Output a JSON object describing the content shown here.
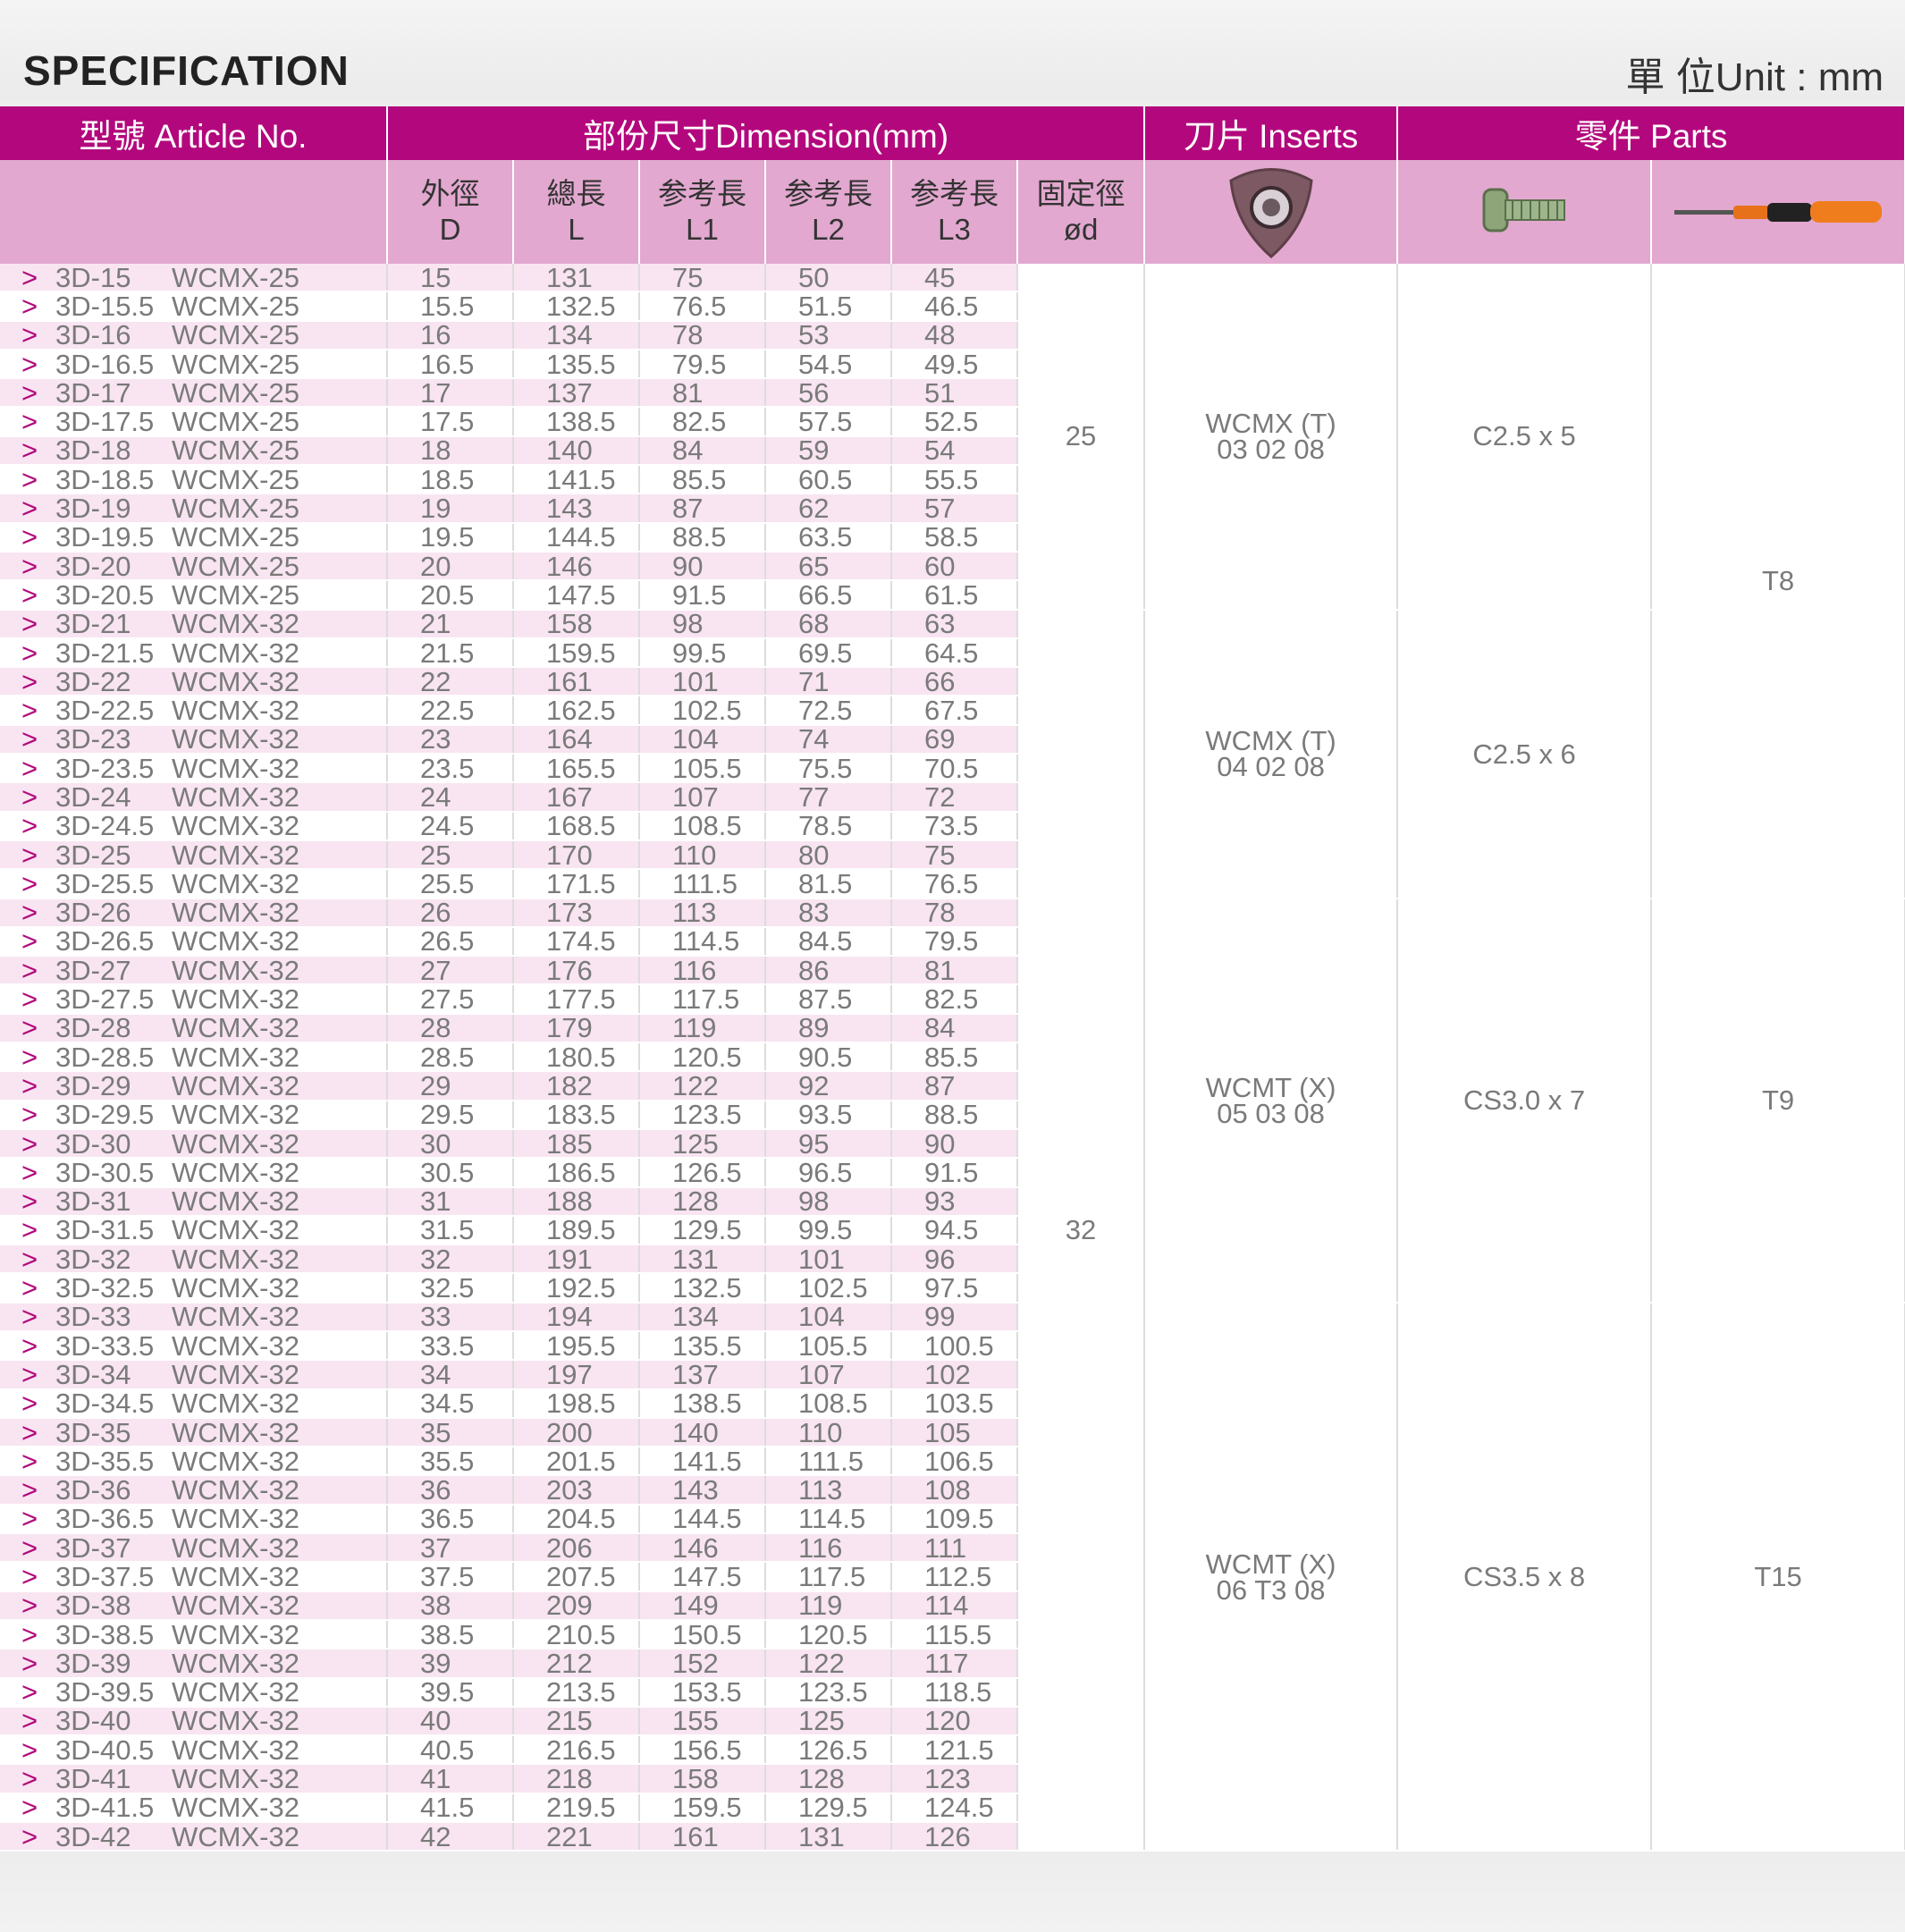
{
  "title": "SPECIFICATION",
  "unit": "單 位Unit : mm",
  "headers": {
    "article": "型號 Article No.",
    "dimension": "部份尺寸Dimension(mm)",
    "inserts": "刀片 Inserts",
    "parts": "零件 Parts"
  },
  "sub_headers": {
    "D_cn": "外徑",
    "D": "D",
    "L_cn": "總長",
    "L": "L",
    "L1_cn": "参考長",
    "L1": "L1",
    "L2_cn": "参考長",
    "L2": "L2",
    "L3_cn": "参考長",
    "L3": "L3",
    "od_cn": "固定徑",
    "od": "ød"
  },
  "icons": {
    "insert": "insert-icon",
    "screw": "screw-icon",
    "driver": "screwdriver-icon"
  },
  "colors": {
    "accent": "#b3087d",
    "subheader": "#e2a8cf",
    "row_alt": "#f8e5f1"
  },
  "rows": [
    [
      "3D-15",
      "WCMX-25",
      "15",
      "131",
      "75",
      "50",
      "45"
    ],
    [
      "3D-15.5",
      "WCMX-25",
      "15.5",
      "132.5",
      "76.5",
      "51.5",
      "46.5"
    ],
    [
      "3D-16",
      "WCMX-25",
      "16",
      "134",
      "78",
      "53",
      "48"
    ],
    [
      "3D-16.5",
      "WCMX-25",
      "16.5",
      "135.5",
      "79.5",
      "54.5",
      "49.5"
    ],
    [
      "3D-17",
      "WCMX-25",
      "17",
      "137",
      "81",
      "56",
      "51"
    ],
    [
      "3D-17.5",
      "WCMX-25",
      "17.5",
      "138.5",
      "82.5",
      "57.5",
      "52.5"
    ],
    [
      "3D-18",
      "WCMX-25",
      "18",
      "140",
      "84",
      "59",
      "54"
    ],
    [
      "3D-18.5",
      "WCMX-25",
      "18.5",
      "141.5",
      "85.5",
      "60.5",
      "55.5"
    ],
    [
      "3D-19",
      "WCMX-25",
      "19",
      "143",
      "87",
      "62",
      "57"
    ],
    [
      "3D-19.5",
      "WCMX-25",
      "19.5",
      "144.5",
      "88.5",
      "63.5",
      "58.5"
    ],
    [
      "3D-20",
      "WCMX-25",
      "20",
      "146",
      "90",
      "65",
      "60"
    ],
    [
      "3D-20.5",
      "WCMX-25",
      "20.5",
      "147.5",
      "91.5",
      "66.5",
      "61.5"
    ],
    [
      "3D-21",
      "WCMX-32",
      "21",
      "158",
      "98",
      "68",
      "63"
    ],
    [
      "3D-21.5",
      "WCMX-32",
      "21.5",
      "159.5",
      "99.5",
      "69.5",
      "64.5"
    ],
    [
      "3D-22",
      "WCMX-32",
      "22",
      "161",
      "101",
      "71",
      "66"
    ],
    [
      "3D-22.5",
      "WCMX-32",
      "22.5",
      "162.5",
      "102.5",
      "72.5",
      "67.5"
    ],
    [
      "3D-23",
      "WCMX-32",
      "23",
      "164",
      "104",
      "74",
      "69"
    ],
    [
      "3D-23.5",
      "WCMX-32",
      "23.5",
      "165.5",
      "105.5",
      "75.5",
      "70.5"
    ],
    [
      "3D-24",
      "WCMX-32",
      "24",
      "167",
      "107",
      "77",
      "72"
    ],
    [
      "3D-24.5",
      "WCMX-32",
      "24.5",
      "168.5",
      "108.5",
      "78.5",
      "73.5"
    ],
    [
      "3D-25",
      "WCMX-32",
      "25",
      "170",
      "110",
      "80",
      "75"
    ],
    [
      "3D-25.5",
      "WCMX-32",
      "25.5",
      "171.5",
      "111.5",
      "81.5",
      "76.5"
    ],
    [
      "3D-26",
      "WCMX-32",
      "26",
      "173",
      "113",
      "83",
      "78"
    ],
    [
      "3D-26.5",
      "WCMX-32",
      "26.5",
      "174.5",
      "114.5",
      "84.5",
      "79.5"
    ],
    [
      "3D-27",
      "WCMX-32",
      "27",
      "176",
      "116",
      "86",
      "81"
    ],
    [
      "3D-27.5",
      "WCMX-32",
      "27.5",
      "177.5",
      "117.5",
      "87.5",
      "82.5"
    ],
    [
      "3D-28",
      "WCMX-32",
      "28",
      "179",
      "119",
      "89",
      "84"
    ],
    [
      "3D-28.5",
      "WCMX-32",
      "28.5",
      "180.5",
      "120.5",
      "90.5",
      "85.5"
    ],
    [
      "3D-29",
      "WCMX-32",
      "29",
      "182",
      "122",
      "92",
      "87"
    ],
    [
      "3D-29.5",
      "WCMX-32",
      "29.5",
      "183.5",
      "123.5",
      "93.5",
      "88.5"
    ],
    [
      "3D-30",
      "WCMX-32",
      "30",
      "185",
      "125",
      "95",
      "90"
    ],
    [
      "3D-30.5",
      "WCMX-32",
      "30.5",
      "186.5",
      "126.5",
      "96.5",
      "91.5"
    ],
    [
      "3D-31",
      "WCMX-32",
      "31",
      "188",
      "128",
      "98",
      "93"
    ],
    [
      "3D-31.5",
      "WCMX-32",
      "31.5",
      "189.5",
      "129.5",
      "99.5",
      "94.5"
    ],
    [
      "3D-32",
      "WCMX-32",
      "32",
      "191",
      "131",
      "101",
      "96"
    ],
    [
      "3D-32.5",
      "WCMX-32",
      "32.5",
      "192.5",
      "132.5",
      "102.5",
      "97.5"
    ],
    [
      "3D-33",
      "WCMX-32",
      "33",
      "194",
      "134",
      "104",
      "99"
    ],
    [
      "3D-33.5",
      "WCMX-32",
      "33.5",
      "195.5",
      "135.5",
      "105.5",
      "100.5"
    ],
    [
      "3D-34",
      "WCMX-32",
      "34",
      "197",
      "137",
      "107",
      "102"
    ],
    [
      "3D-34.5",
      "WCMX-32",
      "34.5",
      "198.5",
      "138.5",
      "108.5",
      "103.5"
    ],
    [
      "3D-35",
      "WCMX-32",
      "35",
      "200",
      "140",
      "110",
      "105"
    ],
    [
      "3D-35.5",
      "WCMX-32",
      "35.5",
      "201.5",
      "141.5",
      "111.5",
      "106.5"
    ],
    [
      "3D-36",
      "WCMX-32",
      "36",
      "203",
      "143",
      "113",
      "108"
    ],
    [
      "3D-36.5",
      "WCMX-32",
      "36.5",
      "204.5",
      "144.5",
      "114.5",
      "109.5"
    ],
    [
      "3D-37",
      "WCMX-32",
      "37",
      "206",
      "146",
      "116",
      "111"
    ],
    [
      "3D-37.5",
      "WCMX-32",
      "37.5",
      "207.5",
      "147.5",
      "117.5",
      "112.5"
    ],
    [
      "3D-38",
      "WCMX-32",
      "38",
      "209",
      "149",
      "119",
      "114"
    ],
    [
      "3D-38.5",
      "WCMX-32",
      "38.5",
      "210.5",
      "150.5",
      "120.5",
      "115.5"
    ],
    [
      "3D-39",
      "WCMX-32",
      "39",
      "212",
      "152",
      "122",
      "117"
    ],
    [
      "3D-39.5",
      "WCMX-32",
      "39.5",
      "213.5",
      "153.5",
      "123.5",
      "118.5"
    ],
    [
      "3D-40",
      "WCMX-32",
      "40",
      "215",
      "155",
      "125",
      "120"
    ],
    [
      "3D-40.5",
      "WCMX-32",
      "40.5",
      "216.5",
      "156.5",
      "126.5",
      "121.5"
    ],
    [
      "3D-41",
      "WCMX-32",
      "41",
      "218",
      "158",
      "128",
      "123"
    ],
    [
      "3D-41.5",
      "WCMX-32",
      "41.5",
      "219.5",
      "159.5",
      "129.5",
      "124.5"
    ],
    [
      "3D-42",
      "WCMX-32",
      "42",
      "221",
      "161",
      "131",
      "126"
    ]
  ],
  "od_groups": [
    {
      "value": "25",
      "rows": 12
    },
    {
      "value": "32",
      "rows": 43
    }
  ],
  "insert_groups": [
    {
      "line1": "WCMX (T)",
      "line2": "03 02 08",
      "rows": 12
    },
    {
      "line1": "WCMX (T)",
      "line2": "04 02 08",
      "rows": 10
    },
    {
      "line1": "WCMT (X)",
      "line2": "05 03 08",
      "rows": 14
    },
    {
      "line1": "WCMT (X)",
      "line2": "06 T3 08",
      "rows": 19
    }
  ],
  "screw_groups": [
    {
      "value": "C2.5 x 5",
      "rows": 12
    },
    {
      "value": "C2.5 x 6",
      "rows": 10
    },
    {
      "value": "CS3.0 x 7",
      "rows": 14
    },
    {
      "value": "CS3.5 x 8",
      "rows": 19
    }
  ],
  "driver_groups": [
    {
      "value": "T8",
      "rows": 22
    },
    {
      "value": "T9",
      "rows": 14
    },
    {
      "value": "T15",
      "rows": 19
    }
  ]
}
